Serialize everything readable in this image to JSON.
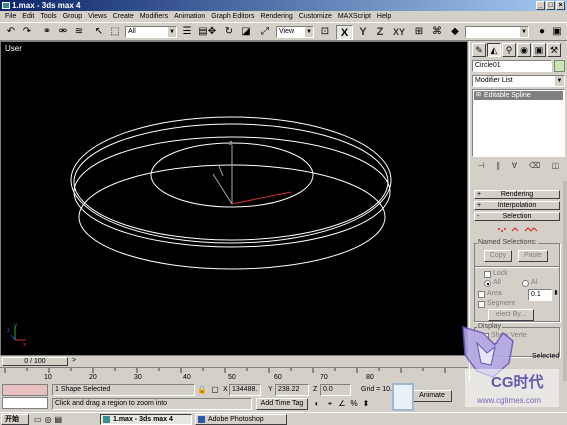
{
  "window": {
    "title": "1.max - 3ds max 4"
  },
  "menubar": {
    "items": [
      "File",
      "Edit",
      "Tools",
      "Group",
      "Views",
      "Create",
      "Modifiers",
      "Animation",
      "Graph Editors",
      "Rendering",
      "Customize",
      "MAXScript",
      "Help"
    ]
  },
  "toolbar": {
    "selection_filter": "All",
    "ref_coord": "View",
    "axis_x": "X",
    "axis_y": "Y",
    "axis_z": "Z",
    "axis_xy": "XY"
  },
  "viewport": {
    "label": "User"
  },
  "timeline": {
    "frame_display": "0 / 100",
    "ticks": [
      "10",
      "20",
      "30",
      "40",
      "50",
      "60",
      "70",
      "80"
    ]
  },
  "status": {
    "selection_text": "1 Shape Selected",
    "prompt_text": "Click and drag a region to zoom into",
    "add_time_tag": "Add Time Tag",
    "x_label": "X",
    "x_value": "134488.",
    "y_label": "Y",
    "y_value": "238.22",
    "z_label": "Z",
    "z_value": "0.0",
    "grid_text": "Grid = 10.0",
    "animate_label": "Animate"
  },
  "command_panel": {
    "object_name": "Circle01",
    "modifier_list": "Modifier List",
    "stack_item": "Editable Spline",
    "rollouts": {
      "rendering": "Rendering",
      "interpolation": "Interpolation",
      "selection": "Selection"
    },
    "named_selections": "Named Selections:",
    "copy": "Copy",
    "paste": "Paste",
    "lock": "Lock",
    "all_radio": "All",
    "al_radio": "Al",
    "area": "Area",
    "area_value": "0.1",
    "segment": "Segment",
    "select_by": "elect By...",
    "display_group": "Display",
    "show_vertex": "Show Verte",
    "selected_text": "Selected"
  },
  "taskbar": {
    "start": "开始",
    "tasks": [
      "1.max - 3ds max 4",
      "Adobe Photoshop"
    ]
  },
  "watermark": {
    "line1": "CG时代",
    "line2": "www.cgtimes.com"
  },
  "colors": {
    "viewport_bg": "#000000",
    "wireframe": "#ffffff",
    "object_color": "#c9e7b0",
    "title_start": "#0a246a",
    "title_end": "#a6caf0",
    "spline_vertex": "#e02020"
  }
}
